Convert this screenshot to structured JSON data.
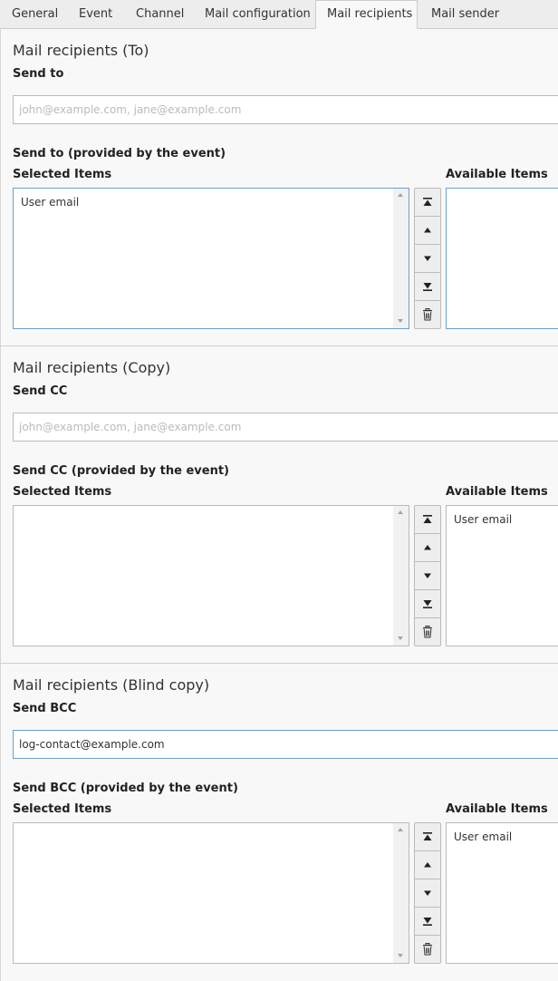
{
  "tabs": [
    "General",
    "Event",
    "Channel",
    "Mail configuration",
    "Mail recipients",
    "Mail sender"
  ],
  "active_tab": "Mail recipients",
  "columns": {
    "selected": "Selected Items",
    "available": "Available Items"
  },
  "sections": [
    {
      "title": "Mail recipients (To)",
      "field_label": "Send to",
      "input_value": "",
      "input_placeholder": "john@example.com, jane@example.com",
      "provided_label": "Send to (provided by the event)",
      "selected_item": "User email",
      "available_item": ""
    },
    {
      "title": "Mail recipients (Copy)",
      "field_label": "Send CC",
      "input_value": "",
      "input_placeholder": "john@example.com, jane@example.com",
      "provided_label": "Send CC (provided by the event)",
      "selected_item": "",
      "available_item": "User email"
    },
    {
      "title": "Mail recipients (Blind copy)",
      "field_label": "Send BCC",
      "input_value": "log-contact@example.com",
      "input_placeholder": "",
      "provided_label": "Send BCC (provided by the event)",
      "selected_item": "",
      "available_item": "User email"
    }
  ],
  "buttons": [
    "move-top-icon",
    "move-up-icon",
    "move-down-icon",
    "move-bottom-icon",
    "trash-icon"
  ],
  "colors": {
    "focus_border": "#6aa1cf",
    "tab_bar": "#ededed",
    "panel_bg": "#f8f8f8"
  }
}
